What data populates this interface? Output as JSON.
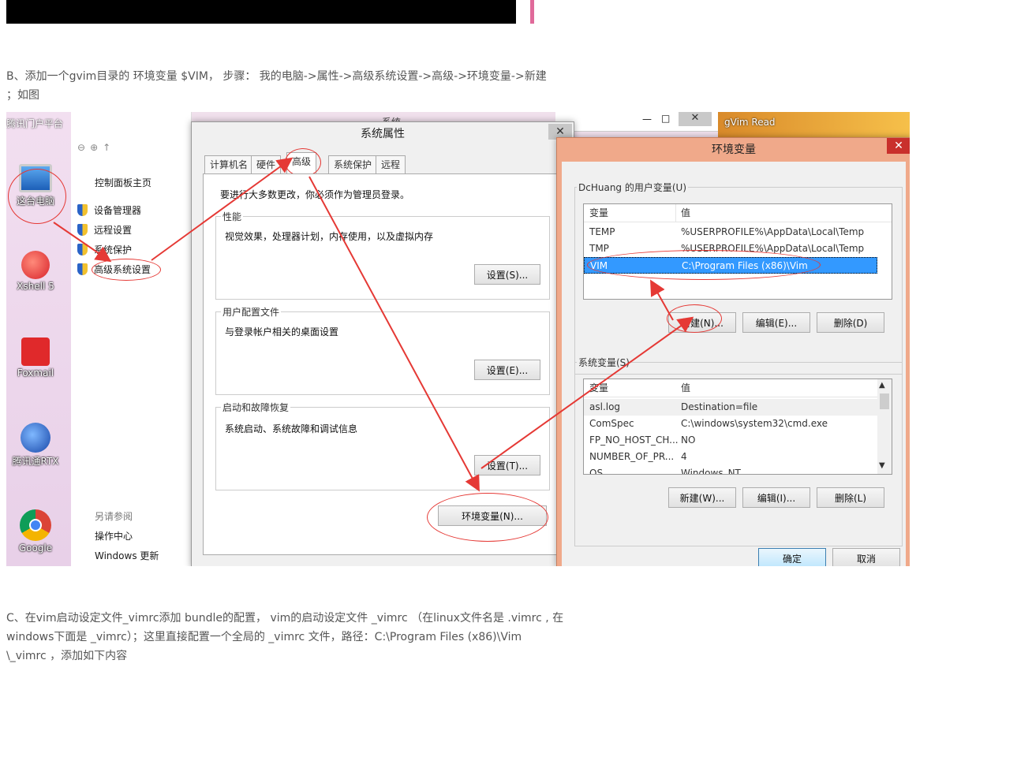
{
  "article": {
    "para_b_line1": "B、添加一个gvim目录的 环境变量 $VIM， 步骤： 我的电脑->属性->高级系统设置->高级->环境变量->新建",
    "para_b_line2": "；如图",
    "para_c_line1": "C、在vim启动设定文件_vimrc添加 bundle的配置， vim的启动设定文件 _vimrc （在linux文件名是 .vimrc , 在",
    "para_c_line2a": "windows下面是 _vimrc）；",
    "para_c_line2b": "这里直接配置一个全局的 _vimrc 文件，路径：C:\\Program Files (x86)\\Vim",
    "para_c_line3": "\\_vimrc ，添加如下内容"
  },
  "desktop": {
    "top_fragment": "腾讯门户平台",
    "icons": [
      {
        "label": "这台电脑",
        "icon": "computer-icon"
      },
      {
        "label": "Xshell 5",
        "icon": "xshell-icon"
      },
      {
        "label": "Foxmail",
        "icon": "foxmail-icon"
      },
      {
        "label": "腾讯通RTX",
        "icon": "rtx-icon"
      },
      {
        "label": "Google",
        "icon": "chrome-icon"
      }
    ],
    "gvim_label": "gVim Read"
  },
  "control_panel": {
    "home": "控制面板主页",
    "links": [
      "设备管理器",
      "远程设置",
      "系统保护",
      "高级系统设置"
    ],
    "see_also": "另请参阅",
    "see_also_links": [
      "操作中心",
      "Windows 更新"
    ]
  },
  "behind_window": {
    "title_fragment": "系统"
  },
  "system_properties": {
    "title": "系统属性",
    "tabs": [
      "计算机名",
      "硬件",
      "高级",
      "系统保护",
      "远程"
    ],
    "active_tab": "高级",
    "admin_note": "要进行大多数更改，你必须作为管理员登录。",
    "performance": {
      "title": "性能",
      "desc": "视觉效果，处理器计划，内存使用，以及虚拟内存",
      "button": "设置(S)..."
    },
    "user_profile": {
      "title": "用户配置文件",
      "desc": "与登录帐户相关的桌面设置",
      "button": "设置(E)..."
    },
    "startup": {
      "title": "启动和故障恢复",
      "desc": "系统启动、系统故障和调试信息",
      "button": "设置(T)..."
    },
    "env_button": "环境变量(N)..."
  },
  "env_dialog": {
    "title": "环境变量",
    "user_group": "DcHuang 的用户变量(U)",
    "col_var": "变量",
    "col_val": "值",
    "user_vars": [
      {
        "name": "TEMP",
        "value": "%USERPROFILE%\\AppData\\Local\\Temp"
      },
      {
        "name": "TMP",
        "value": "%USERPROFILE%\\AppData\\Local\\Temp"
      },
      {
        "name": "VIM",
        "value": "C:\\Program Files (x86)\\Vim"
      }
    ],
    "selected_user_var": "VIM",
    "user_buttons": {
      "new": "新建(N)...",
      "edit": "编辑(E)...",
      "delete": "删除(D)"
    },
    "sys_group": "系统变量(S)",
    "sys_vars": [
      {
        "name": "asl.log",
        "value": "Destination=file"
      },
      {
        "name": "ComSpec",
        "value": "C:\\windows\\system32\\cmd.exe"
      },
      {
        "name": "FP_NO_HOST_CH...",
        "value": "NO"
      },
      {
        "name": "NUMBER_OF_PR...",
        "value": "4"
      },
      {
        "name": "OS",
        "value": "Windows_NT"
      }
    ],
    "sys_buttons": {
      "new": "新建(W)...",
      "edit": "编辑(I)...",
      "delete": "删除(L)"
    },
    "ok": "确定",
    "cancel": "取消"
  },
  "colors": {
    "accent_red": "#e53935",
    "selection": "#3399ff",
    "env_titlebar": "#f0a98a"
  }
}
